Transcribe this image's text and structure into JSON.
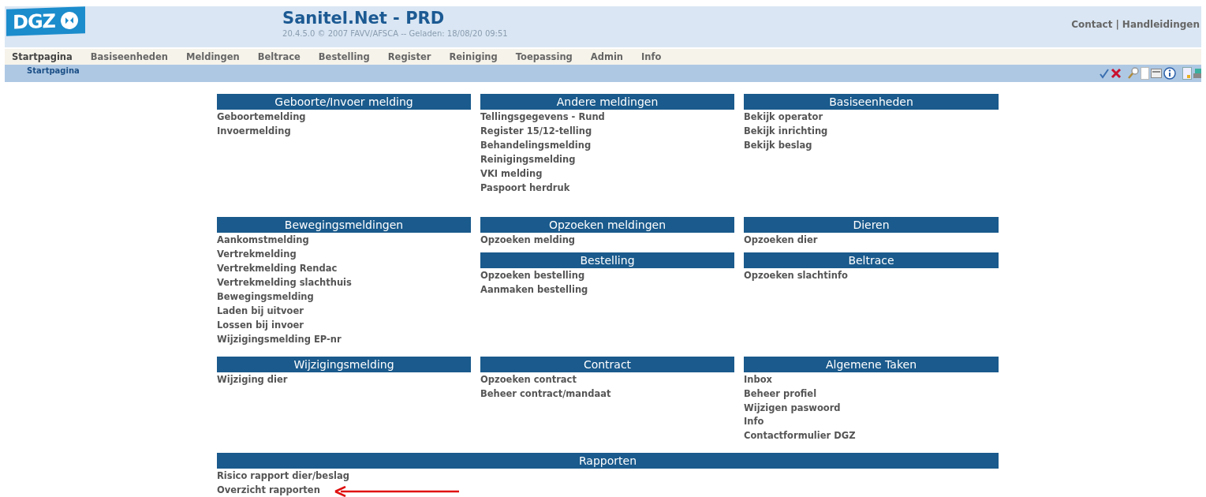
{
  "logo": {
    "text": "DGZ"
  },
  "header": {
    "title": "Sanitel.Net - PRD",
    "subtitle": "20.4.5.0 © 2007 FAVV/AFSCA -- Geladen: 18/08/20 09:51",
    "links": [
      "Contact",
      "Handleidingen"
    ],
    "separator": "|"
  },
  "menu": [
    {
      "label": "Startpagina",
      "selected": true
    },
    {
      "label": "Basiseenheden",
      "selected": false
    },
    {
      "label": "Meldingen",
      "selected": false
    },
    {
      "label": "Beltrace",
      "selected": false
    },
    {
      "label": "Bestelling",
      "selected": false
    },
    {
      "label": "Register",
      "selected": false
    },
    {
      "label": "Reiniging",
      "selected": false
    },
    {
      "label": "Toepassing",
      "selected": false
    },
    {
      "label": "Admin",
      "selected": false
    },
    {
      "label": "Info",
      "selected": false
    }
  ],
  "breadcrumb": "Startpagina",
  "rows": [
    [
      [
        {
          "title": "Geboorte/Invoer melding",
          "links": [
            "Geboortemelding",
            "Invoermelding"
          ]
        }
      ],
      [
        {
          "title": "Andere meldingen",
          "links": [
            "Tellingsgegevens - Rund",
            "Register 15/12-telling",
            "Behandelingsmelding",
            "Reinigingsmelding",
            "VKI melding",
            "Paspoort herdruk"
          ]
        }
      ],
      [
        {
          "title": "Basiseenheden",
          "links": [
            "Bekijk operator",
            "Bekijk inrichting",
            "Bekijk beslag"
          ]
        }
      ]
    ],
    [
      [
        {
          "title": "Bewegingsmeldingen",
          "links": [
            "Aankomstmelding",
            "Vertrekmelding",
            "Vertrekmelding Rendac",
            "Vertrekmelding slachthuis",
            "Bewegingsmelding",
            "Laden bij uitvoer",
            "Lossen bij invoer",
            "Wijzigingsmelding EP-nr"
          ]
        }
      ],
      [
        {
          "title": "Opzoeken meldingen",
          "links": [
            "Opzoeken melding"
          ]
        },
        {
          "title": "Bestelling",
          "links": [
            "Opzoeken bestelling",
            "Aanmaken bestelling"
          ]
        }
      ],
      [
        {
          "title": "Dieren",
          "links": [
            "Opzoeken dier"
          ]
        },
        {
          "title": "Beltrace",
          "links": [
            "Opzoeken slachtinfo"
          ]
        }
      ]
    ],
    [
      [
        {
          "title": "Wijzigingsmelding",
          "links": [
            "Wijziging dier"
          ]
        }
      ],
      [
        {
          "title": "Contract",
          "links": [
            "Opzoeken contract",
            "Beheer contract/mandaat"
          ]
        }
      ],
      [
        {
          "title": "Algemene Taken",
          "links": [
            "Inbox",
            "Beheer profiel",
            "Wijzigen paswoord",
            "Info",
            "Contactformulier DGZ"
          ]
        }
      ]
    ]
  ],
  "wide": {
    "title": "Rapporten",
    "links": [
      "Risico rapport dier/beslag",
      "Overzicht rapporten"
    ]
  }
}
